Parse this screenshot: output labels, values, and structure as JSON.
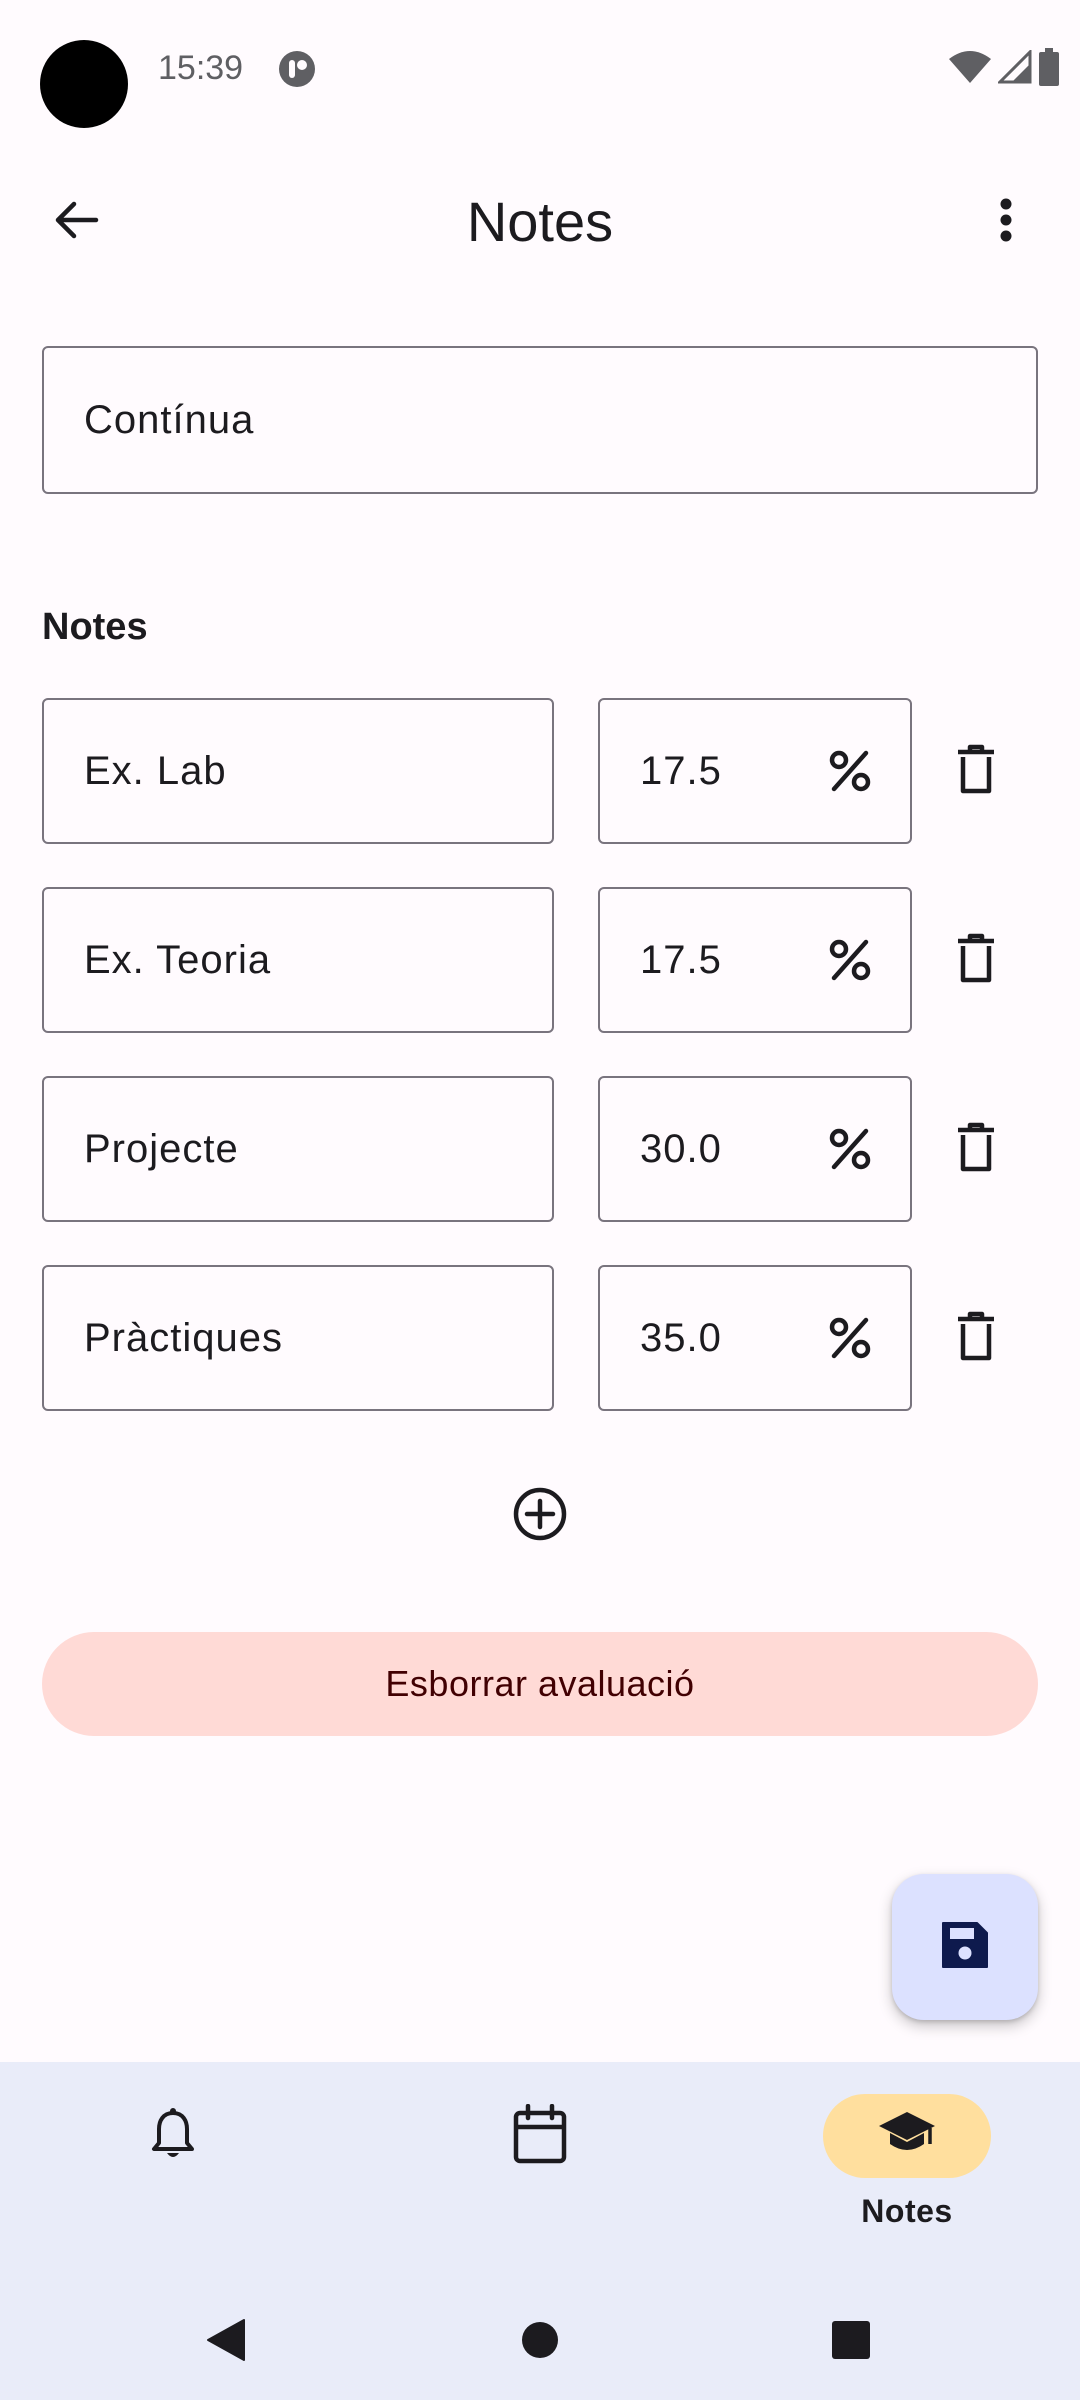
{
  "status_bar": {
    "time": "15:39",
    "icons": [
      "camera-cutout",
      "app-notification-icon",
      "wifi-icon",
      "signal-icon",
      "battery-icon"
    ]
  },
  "app_bar": {
    "title": "Notes",
    "back_icon": "arrow-back-icon",
    "more_icon": "more-vert-icon"
  },
  "evaluation": {
    "name_value": "Contínua"
  },
  "grades_section": {
    "label": "Notes",
    "items": [
      {
        "name": "Ex. Lab",
        "weight": "17.5"
      },
      {
        "name": "Ex. Teoria",
        "weight": "17.5"
      },
      {
        "name": "Projecte",
        "weight": "30.0"
      },
      {
        "name": "Pràctiques",
        "weight": "35.0"
      }
    ],
    "percent_icon": "percent-icon",
    "delete_icon": "trash-icon",
    "add_icon": "add-circle-icon"
  },
  "actions": {
    "delete_evaluation_label": "Esborrar avaluació",
    "save_icon": "save-icon"
  },
  "bottom_nav": {
    "items": [
      {
        "icon": "bell-icon",
        "label": "",
        "active": false
      },
      {
        "icon": "calendar-icon",
        "label": "",
        "active": false
      },
      {
        "icon": "graduation-cap-icon",
        "label": "Notes",
        "active": true
      }
    ]
  },
  "system_nav": [
    "back-triangle-icon",
    "home-circle-icon",
    "recents-square-icon"
  ],
  "colors": {
    "background": "#fffbfe",
    "outline": "#79747e",
    "delete_button": "#ffdad6",
    "fab": "#dce1ff",
    "nav_bar": "#e9ecf9",
    "nav_active_indicator": "#ffdf9e"
  }
}
